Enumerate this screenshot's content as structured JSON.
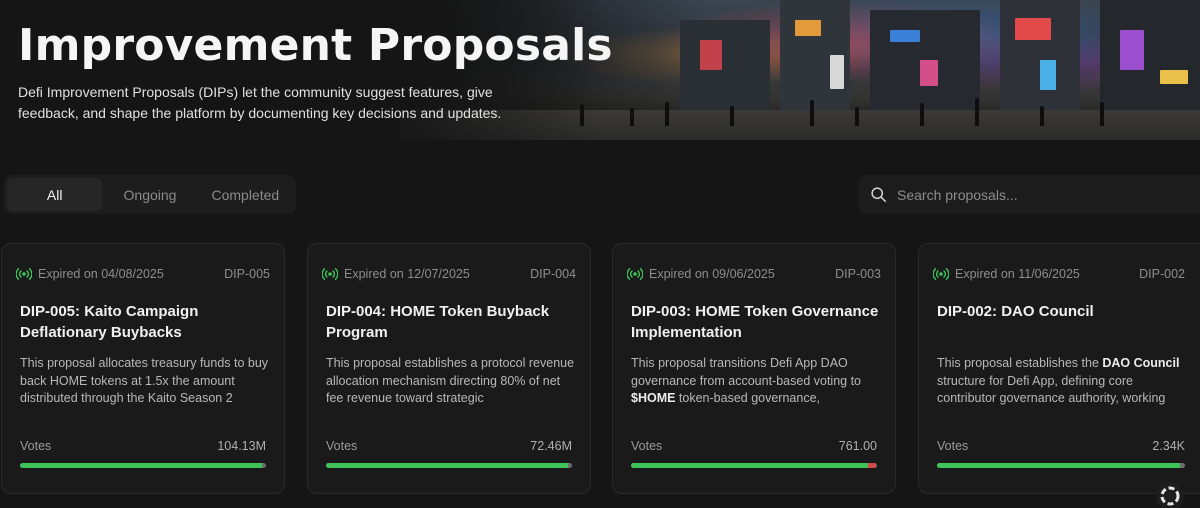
{
  "hero": {
    "title": "Improvement Proposals",
    "description": "Defi Improvement Proposals (DIPs) let the community suggest features, give feedback, and shape the platform by documenting key decisions and updates."
  },
  "tabs": [
    {
      "label": "All",
      "active": true
    },
    {
      "label": "Ongoing",
      "active": false
    },
    {
      "label": "Completed",
      "active": false
    }
  ],
  "search": {
    "placeholder": "Search proposals...",
    "value": ""
  },
  "colors": {
    "accent_green": "#3ec25a",
    "against_red": "#d24a4a",
    "card_bg": "#1a1a1a"
  },
  "proposals": [
    {
      "status": "Expired on 04/08/2025",
      "id": "DIP-005",
      "title": "DIP-005: Kaito Campaign Deflationary Buybacks",
      "description": "This proposal allocates treasury funds to buy back HOME tokens at 1.5x the amount distributed through the Kaito Season 2",
      "votes_label": "Votes",
      "votes": "104.13M",
      "for_fraction": 0.985,
      "against_fraction": 0.0
    },
    {
      "status": "Expired on 12/07/2025",
      "id": "DIP-004",
      "title": "DIP-004: HOME Token Buyback Program",
      "description": "This proposal establishes a protocol revenue allocation mechanism directing 80% of net fee revenue toward strategic",
      "votes_label": "Votes",
      "votes": "72.46M",
      "for_fraction": 0.985,
      "against_fraction": 0.0
    },
    {
      "status": "Expired on 09/06/2025",
      "id": "DIP-003",
      "title": "DIP-003: HOME Token Governance Implementation",
      "description_parts": [
        "This proposal transitions Defi App DAO governance from account-based voting to ",
        "$HOME",
        " token-based governance,"
      ],
      "votes_label": "Votes",
      "votes": "761.00",
      "for_fraction": 0.965,
      "against_fraction": 0.03
    },
    {
      "status": "Expired on 11/06/2025",
      "id": "DIP-002",
      "title": "DIP-002: DAO Council",
      "description_parts": [
        "This proposal establishes the ",
        "DAO Council",
        " structure for Defi App, defining core contributor governance authority, working"
      ],
      "votes_label": "Votes",
      "votes": "2.34K",
      "for_fraction": 0.98,
      "against_fraction": 0.0
    }
  ]
}
